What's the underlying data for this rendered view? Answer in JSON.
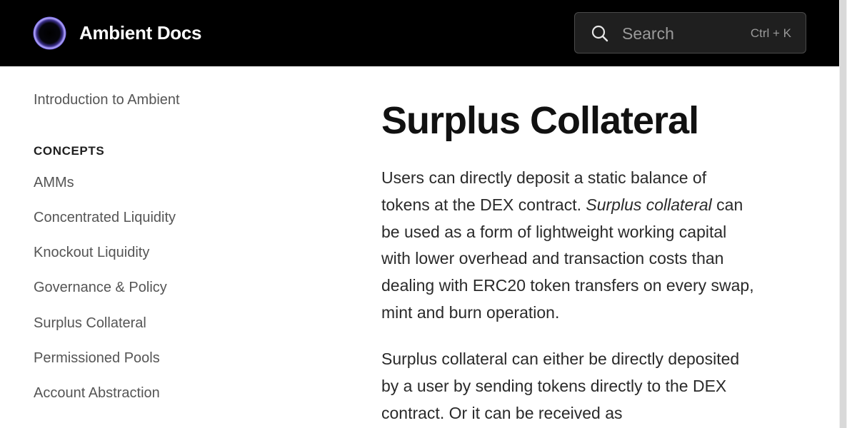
{
  "header": {
    "brand": "Ambient Docs",
    "search": {
      "placeholder": "Search",
      "shortcut": "Ctrl + K"
    },
    "icons": {
      "logo": "ambient-logo-ring",
      "search": "search-icon"
    },
    "colors": {
      "background": "#000000",
      "logo_glow": "#8c7cf0"
    }
  },
  "sidebar": {
    "intro": "Introduction to Ambient",
    "section_heading": "CONCEPTS",
    "items": [
      {
        "label": "AMMs"
      },
      {
        "label": "Concentrated Liquidity"
      },
      {
        "label": "Knockout Liquidity"
      },
      {
        "label": "Governance & Policy"
      },
      {
        "label": "Surplus Collateral"
      },
      {
        "label": "Permissioned Pools"
      },
      {
        "label": "Account Abstraction"
      }
    ]
  },
  "main": {
    "title": "Surplus Collateral",
    "paragraph1": {
      "before": "Users can directly deposit a static balance of tokens at the DEX contract. ",
      "emphasis": "Surplus collateral",
      "after": " can be used as a form of lightweight working capital with lower overhead and transaction costs than dealing with ERC20 token transfers on every swap, mint and burn operation."
    },
    "paragraph2": "Surplus collateral can either be directly deposited by a user by sending tokens directly to the DEX contract. Or it can be received as"
  }
}
